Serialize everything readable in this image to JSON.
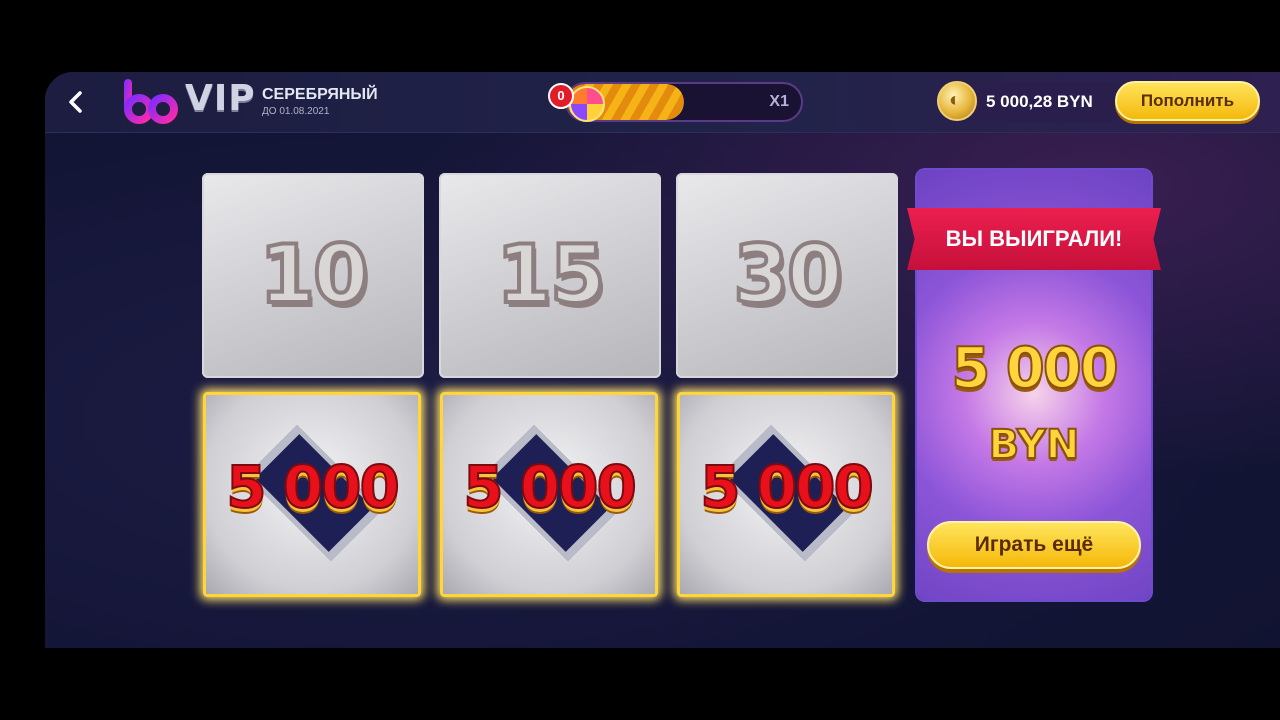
{
  "header": {
    "back_icon": "chevron-left-icon",
    "logo_icon": "bb-logo-icon",
    "vip_label": "VIP",
    "tier_name": "СЕРЕБРЯНЫЙ",
    "tier_expiry": "ДО 01.08.2021",
    "bonus_counter": "0",
    "bonus_multiplier": "X1",
    "bonus_progress_fraction": 0.5,
    "coin_icon": "coin-icon",
    "balance": "5 000,28 BYN",
    "topup_label": "Пополнить"
  },
  "game": {
    "top_tiles": [
      "10",
      "15",
      "30"
    ],
    "won_tiles": [
      "5 000",
      "5 000",
      "5 000"
    ]
  },
  "prize_panel": {
    "banner": "ВЫ ВЫИГРАЛИ!",
    "amount": "5 000",
    "currency": "BYN",
    "play_again_label": "Играть ещё"
  },
  "colors": {
    "accent_gold": "#f5b80a",
    "ribbon_red": "#e21d4f",
    "panel_purple": "#8c55d8",
    "background": "#131536"
  }
}
